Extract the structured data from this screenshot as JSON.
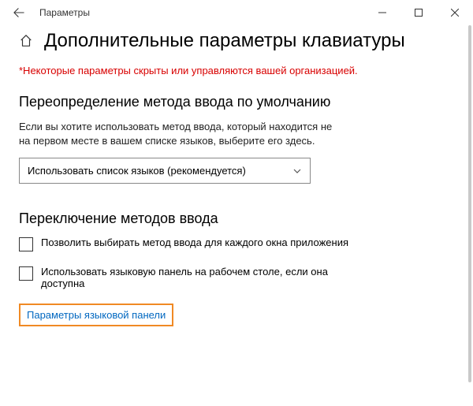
{
  "window": {
    "title": "Параметры"
  },
  "page": {
    "heading": "Дополнительные параметры клавиатуры",
    "warning": "*Некоторые параметры скрыты или управляются вашей организацией."
  },
  "override": {
    "heading": "Переопределение метода ввода по умолчанию",
    "description": "Если вы хотите использовать метод ввода, который находится не на первом месте в вашем списке языков, выберите его здесь.",
    "selected": "Использовать список языков (рекомендуется)"
  },
  "switching": {
    "heading": "Переключение методов ввода",
    "checkbox1": "Позволить выбирать метод ввода для каждого окна приложения",
    "checkbox2": "Использовать языковую панель на рабочем столе, если она доступна",
    "link": "Параметры языковой панели"
  }
}
